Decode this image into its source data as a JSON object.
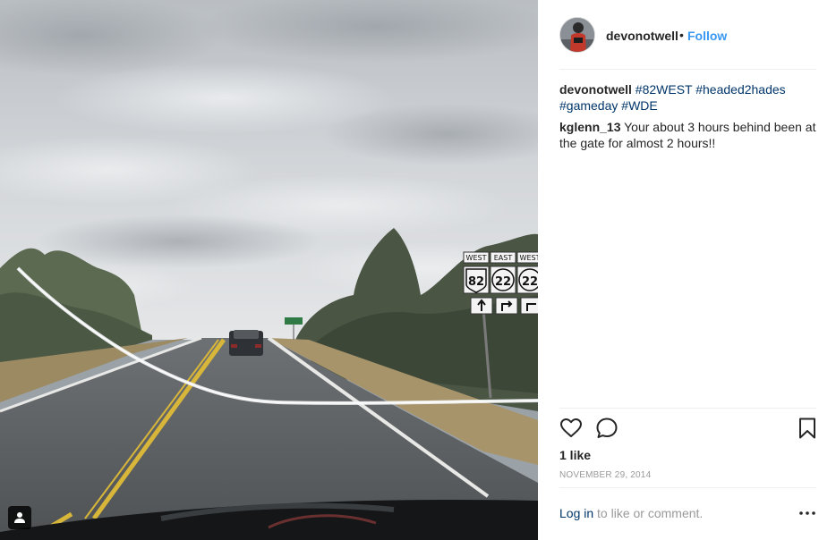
{
  "post": {
    "username": "devonotwell",
    "separator": "•",
    "follow_label": "Follow",
    "caption": {
      "username": "devonotwell",
      "tags": [
        "#82WEST",
        "#headed2hades",
        "#gameday",
        "#WDE"
      ]
    },
    "comments": [
      {
        "username": "kglenn_13",
        "text": "Your about 3 hours behind been at the gate for almost 2 hours!!"
      }
    ],
    "likes": "1 like",
    "date": "NOVEMBER 29, 2014",
    "login": {
      "link": "Log in",
      "rest": " to like or comment."
    },
    "icons": {
      "like": "heart-icon",
      "comment": "speech-bubble-icon",
      "save": "bookmark-icon",
      "more": "more-options-icon",
      "tagged": "user-tag-icon"
    },
    "signs": {
      "dir1": "WEST",
      "dir2": "EAST",
      "dir3": "WEST",
      "route1": "82",
      "route2": "22",
      "route3": "22"
    },
    "colors": {
      "link": "#003569",
      "follow": "#3897f0",
      "muted": "#999999",
      "text": "#262626"
    }
  }
}
